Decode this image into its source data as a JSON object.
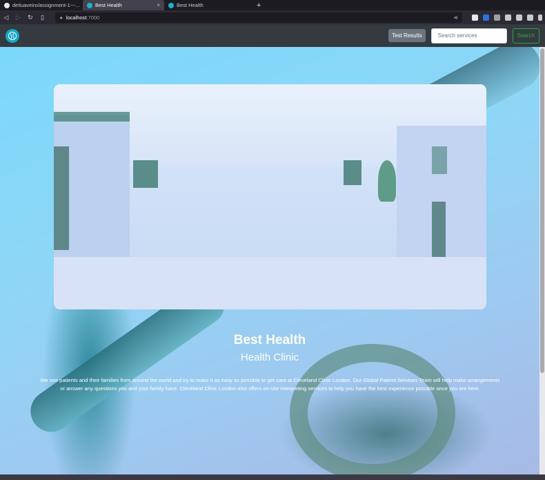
{
  "browser": {
    "tabs": [
      {
        "label": "detiuaveiro/assignment-1---..."
      },
      {
        "label": "Best Health"
      },
      {
        "label": "Best Health"
      }
    ],
    "url_host": "localhost",
    "url_port": ":7000"
  },
  "navbar": {
    "test_results_label": "Test Results",
    "search_placeholder": "Search services",
    "search_button_label": "Search"
  },
  "hero": {
    "title": "Best Health",
    "subtitle": "Health Clinic",
    "description": "We see patients and their families from around the world and try to make it as easy as possible to get care at Cleveland Clinic London. Our Global Patient Services Team will help make arrangements or answer any questions you and your family have. Cleveland Clinic London also offers on-site interpreting services to help you have the best experience possible once you are here."
  },
  "colors": {
    "navbar_bg": "#343a40",
    "accent": "#16a7c6",
    "search_green": "#28a745",
    "hero_tint": "#8fd6f6"
  }
}
